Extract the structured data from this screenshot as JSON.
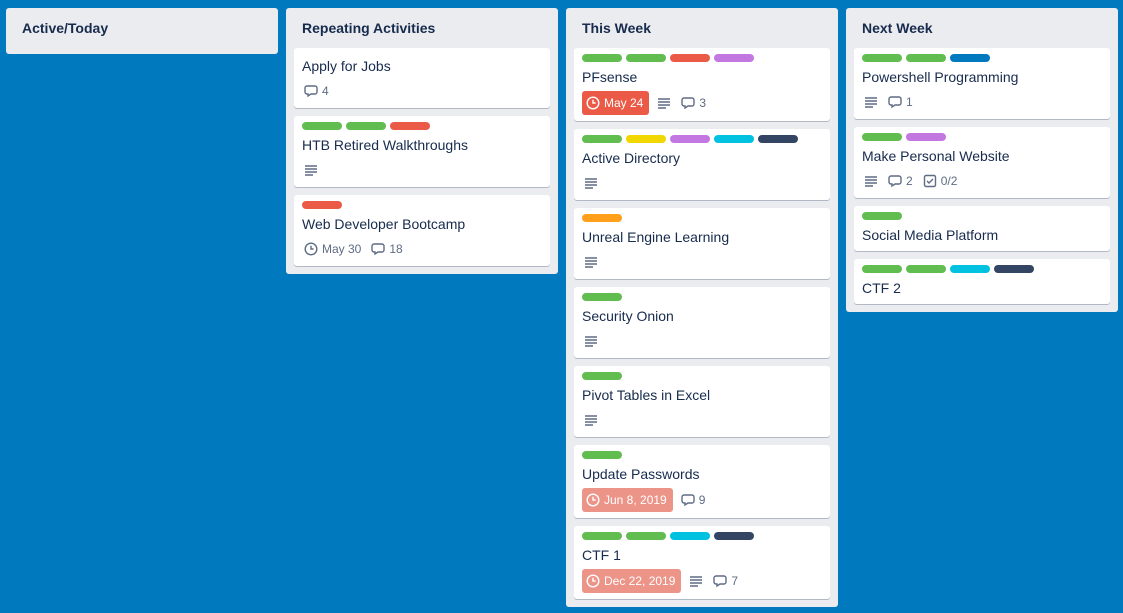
{
  "colors": {
    "green": "#61bd4f",
    "yellow": "#f2d600",
    "orange": "#ff9f1a",
    "red": "#eb5a46",
    "purple": "#c377e0",
    "blue": "#0079bf",
    "sky": "#00c2e0",
    "black": "#344563"
  },
  "lists": [
    {
      "title": "Active/Today",
      "cards": []
    },
    {
      "title": "Repeating Activities",
      "cards": [
        {
          "labels": [],
          "title": "Apply for Jobs",
          "comments": "4"
        },
        {
          "labels": [
            "green",
            "green",
            "red"
          ],
          "title": "HTB Retired Walkthroughs",
          "description_icon": "description-icon"
        },
        {
          "labels": [
            "red"
          ],
          "title": "Web Developer Bootcamp",
          "due": "May 30",
          "comments": "18"
        }
      ]
    },
    {
      "title": "This Week",
      "cards": [
        {
          "labels": [
            "green",
            "green",
            "red",
            "purple"
          ],
          "title": "PFsense",
          "due": "May 24",
          "due_status": "overdue",
          "description_icon": "description-icon",
          "comments": "3"
        },
        {
          "labels": [
            "green",
            "yellow",
            "purple",
            "sky",
            "black"
          ],
          "title": "Active Directory",
          "description_icon": "description-icon"
        },
        {
          "labels": [
            "orange"
          ],
          "title": "Unreal Engine Learning",
          "description_icon": "description-icon"
        },
        {
          "labels": [
            "green"
          ],
          "title": "Security Onion",
          "description_icon": "description-icon"
        },
        {
          "labels": [
            "green"
          ],
          "title": "Pivot Tables in Excel",
          "description_icon": "description-icon"
        },
        {
          "labels": [
            "green"
          ],
          "title": "Update Passwords",
          "due": "Jun 8, 2019",
          "due_status": "past",
          "comments": "9"
        },
        {
          "labels": [
            "green",
            "green",
            "sky",
            "black"
          ],
          "title": "CTF 1",
          "due": "Dec 22, 2019",
          "due_status": "past",
          "description_icon": "description-icon",
          "comments": "7"
        }
      ]
    },
    {
      "title": "Next Week",
      "cards": [
        {
          "labels": [
            "green",
            "green",
            "blue"
          ],
          "title": "Powershell Programming",
          "description_icon": "description-icon",
          "comments": "1"
        },
        {
          "labels": [
            "green",
            "purple"
          ],
          "title": "Make Personal Website",
          "description_icon": "description-icon",
          "comments": "2",
          "checklist": "0/2"
        },
        {
          "labels": [
            "green"
          ],
          "title": "Social Media Platform"
        },
        {
          "labels": [
            "green",
            "green",
            "sky",
            "black"
          ],
          "title": "CTF 2"
        }
      ]
    }
  ]
}
